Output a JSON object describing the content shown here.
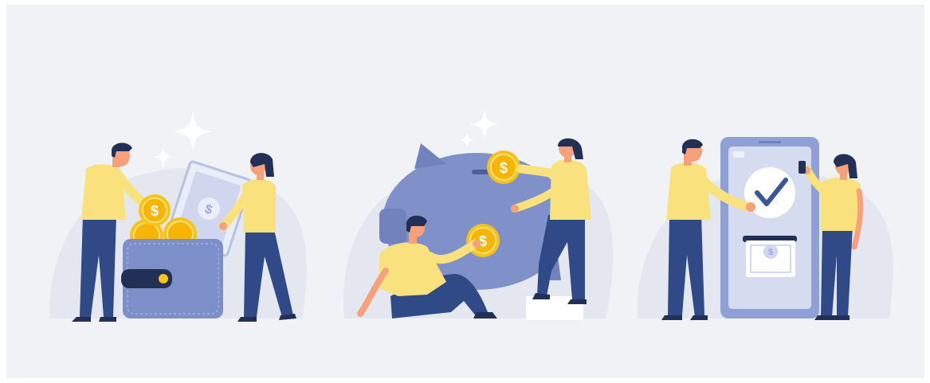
{
  "palette": {
    "background": "#f1f2f6",
    "blob": "#e4e7f0",
    "shirt": "#f9e27d",
    "pants": "#2f4a86",
    "skin": "#f6a07c",
    "hair": "#223055",
    "coin": "#f7c21a",
    "coin_inner": "#f5b500",
    "wallet": "#7d8fc8",
    "piggy": "#8091c9",
    "phone": "#8ea0d6",
    "screen": "#d6dcf0",
    "cash": "#cfd6ee",
    "sparkle": "#ffffff"
  },
  "coin_symbol": "$",
  "scenes": [
    {
      "name": "wallet-scene",
      "icons": [
        "wallet-icon",
        "banknote-icon",
        "coin-icon"
      ]
    },
    {
      "name": "piggy-bank-scene",
      "icons": [
        "piggy-bank-icon",
        "coin-icon"
      ]
    },
    {
      "name": "mobile-payment-scene",
      "icons": [
        "smartphone-icon",
        "checkmark-icon",
        "banknote-icon"
      ]
    }
  ]
}
